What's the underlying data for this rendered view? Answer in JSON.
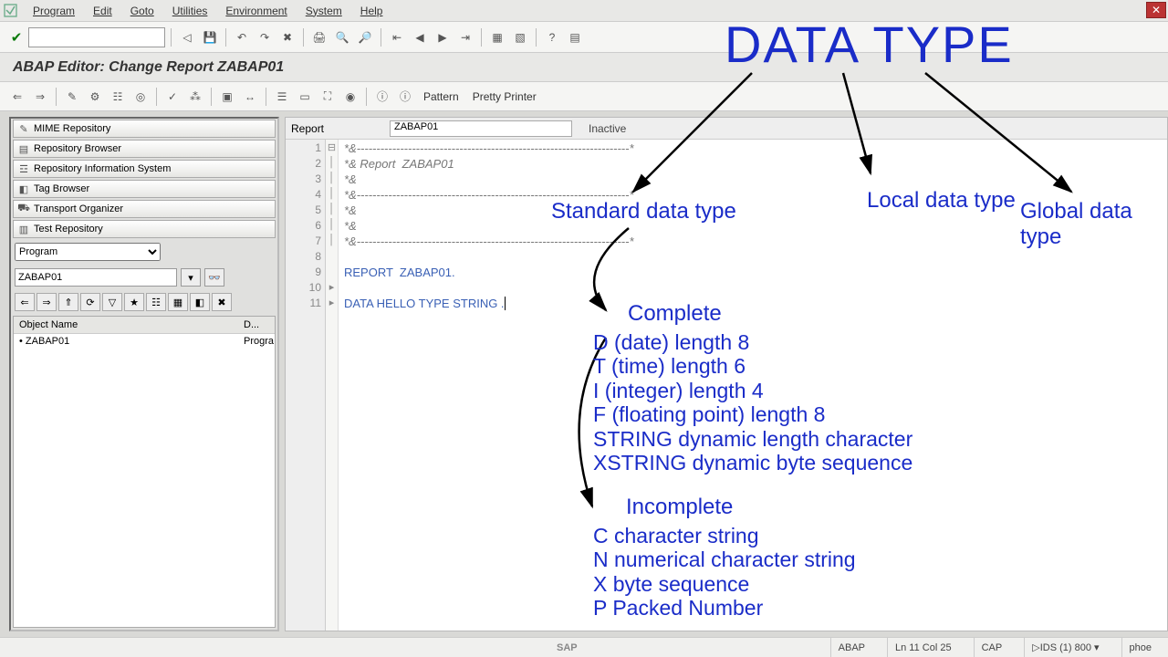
{
  "menu": {
    "items": [
      "Program",
      "Edit",
      "Goto",
      "Utilities",
      "Environment",
      "System",
      "Help"
    ]
  },
  "title": "ABAP Editor: Change Report ZABAP01",
  "toolbar2": {
    "pattern": "Pattern",
    "pretty": "Pretty Printer"
  },
  "nav": {
    "btns": [
      "MIME Repository",
      "Repository Browser",
      "Repository Information System",
      "Tag Browser",
      "Transport Organizer",
      "Test Repository"
    ],
    "type_label": "Program",
    "object_value": "ZABAP01",
    "col1": "Object Name",
    "col2": "D...",
    "row_obj": "ZABAP01",
    "row_desc": "Progra"
  },
  "editor": {
    "report_label": "Report",
    "report_value": "ZABAP01",
    "status": "Inactive",
    "lines": {
      "l1": "*&---------------------------------------------------------------------*",
      "l2": "*& Report  ZABAP01",
      "l3": "*&",
      "l4": "*&---------------------------------------------------------------------*",
      "l5": "*&",
      "l6": "*&",
      "l7": "*&---------------------------------------------------------------------*",
      "l8": "",
      "l9": "REPORT  ZABAP01.",
      "l10": "",
      "l11": "DATA HELLO TYPE STRING ."
    }
  },
  "overlay": {
    "title": "DATA TYPE",
    "branch1": "Standard data type",
    "branch2": "Local data type",
    "branch3": "Global data type",
    "section1": "Complete",
    "complete": [
      "D (date) length 8",
      "T (time) length 6",
      "I (integer) length 4",
      "F (floating point) length 8",
      "STRING dynamic length character",
      "XSTRING dynamic byte sequence"
    ],
    "section2": "Incomplete",
    "incomplete": [
      "C character string",
      "N numerical character string",
      "X byte sequence",
      "P Packed Number"
    ]
  },
  "status": {
    "mode": "ABAP",
    "pos": "Ln  11 Col  25",
    "caps": "CAP",
    "sys": "IDS (1) 800 ▾",
    "host": "phoe"
  }
}
